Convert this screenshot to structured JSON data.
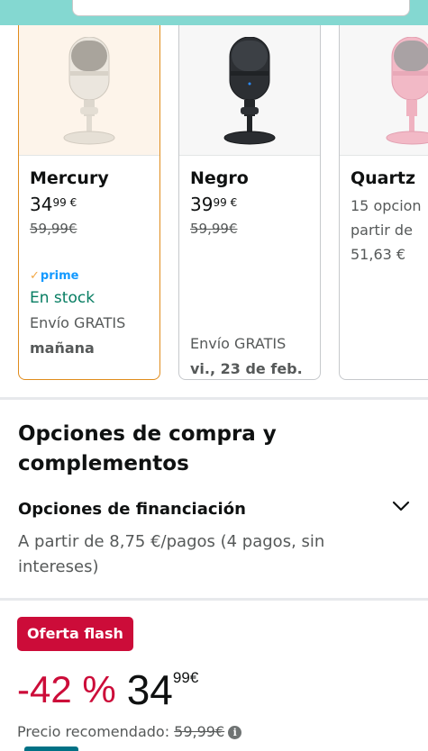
{
  "variants": [
    {
      "name": "Mercury",
      "price_whole": "34",
      "price_fraction": "99",
      "currency": "€",
      "list_price": "59,99€",
      "prime": "prime",
      "availability": "En stock",
      "shipping": "Envío GRATIS",
      "delivery": "mañana",
      "mic_color": "#e9e4dc",
      "selected": true
    },
    {
      "name": "Negro",
      "price_whole": "39",
      "price_fraction": "99",
      "currency": "€",
      "list_price": "59,99€",
      "shipping": "Envío GRATIS",
      "delivery": "vi., 23 de feb.",
      "mic_color": "#2a2d31"
    },
    {
      "name": "Quartz",
      "line1": "15 opcion",
      "line2": "partir de",
      "line3": "51,63 €",
      "mic_color": "#f0b3c2"
    }
  ],
  "purchase_options": {
    "title": "Opciones de compra y complementos",
    "financing_title": "Opciones de financiación",
    "financing_text": "A partir de 8,75 €/pagos (4 pagos, sin intereses)"
  },
  "deal": {
    "badge": "Oferta flash",
    "discount": "-42 %",
    "price_whole": "34",
    "price_fraction": "99",
    "currency": "€",
    "recommended_label": "Precio recomendado:",
    "recommended_price": "59,99€"
  },
  "colors": {
    "accent_red": "#cc0c39",
    "stock_green": "#067d62",
    "selected_border": "#e08c1c",
    "prime_blue": "#1399ff"
  }
}
